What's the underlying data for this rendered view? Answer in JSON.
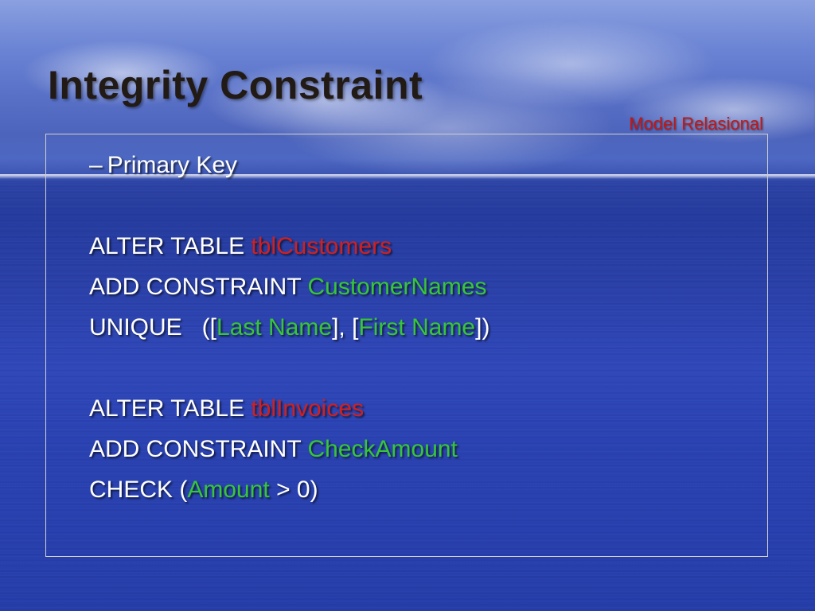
{
  "title": "Integrity Constraint",
  "subtitle": "Model Relasional",
  "bullet": {
    "dash": "–",
    "label": "Primary Key"
  },
  "code1": {
    "l1a": "ALTER TABLE ",
    "l1b": "tblCustomers",
    "l2a": "ADD CONSTRAINT ",
    "l2b": "CustomerNames",
    "l3a": "UNIQUE   ([",
    "l3b": "Last Name",
    "l3c": "], [",
    "l3d": "First Name",
    "l3e": "])"
  },
  "code2": {
    "l1a": "ALTER TABLE ",
    "l1b": "tblInvoices",
    "l2a": "ADD CONSTRAINT ",
    "l2b": "CheckAmount",
    "l3a": "CHECK (",
    "l3b": "Amount",
    "l3c": " > 0)"
  }
}
